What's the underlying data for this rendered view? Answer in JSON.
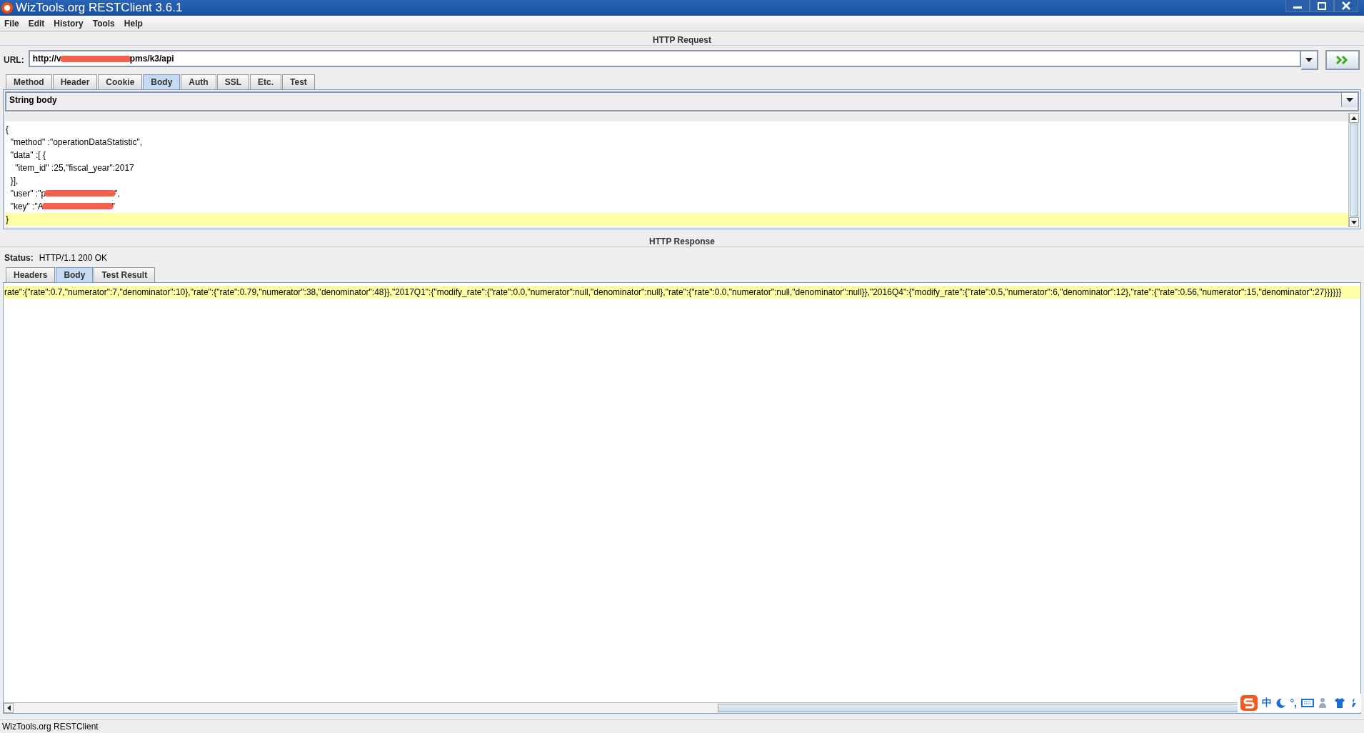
{
  "window": {
    "title": "WizTools.org RESTClient 3.6.1"
  },
  "menu": [
    {
      "label": "File"
    },
    {
      "label": "Edit"
    },
    {
      "label": "History"
    },
    {
      "label": "Tools"
    },
    {
      "label": "Help"
    }
  ],
  "request": {
    "title": "HTTP Request",
    "url_label": "URL:",
    "url_start": "http://v",
    "url_end": "pms/k3/api",
    "tabs": [
      {
        "label": "Method",
        "selected": false
      },
      {
        "label": "Header",
        "selected": false
      },
      {
        "label": "Cookie",
        "selected": false
      },
      {
        "label": "Body",
        "selected": true
      },
      {
        "label": "Auth",
        "selected": false
      },
      {
        "label": "SSL",
        "selected": false
      },
      {
        "label": "Etc.",
        "selected": false
      },
      {
        "label": "Test",
        "selected": false
      }
    ],
    "body_type": "String body",
    "lines": [
      {
        "text": "{",
        "highlighted": false
      },
      {
        "text": "  \"method\" :\"operationDataStatistic\",",
        "highlighted": false
      },
      {
        "text": "  \"data\" :[ {",
        "highlighted": false
      },
      {
        "text": "    \"item_id\" :25,\"fiscal_year\":2017",
        "highlighted": false
      },
      {
        "text": "  }],",
        "highlighted": false
      },
      {
        "text": "  \"user\" :\"p",
        "after": "\",",
        "highlighted": false
      },
      {
        "text": "  \"key\" :\"A",
        "after": "\"",
        "highlighted": false
      },
      {
        "text": "}",
        "highlighted": true
      }
    ]
  },
  "response": {
    "title": "HTTP Response",
    "status_label": "Status:",
    "status": "HTTP/1.1 200 OK",
    "tabs": [
      {
        "label": "Headers",
        "selected": false
      },
      {
        "label": "Body",
        "selected": true
      },
      {
        "label": "Test Result",
        "selected": false
      }
    ],
    "lines": [
      {
        "text": "rate\":{\"rate\":0.7,\"numerator\":7,\"denominator\":10},\"rate\":{\"rate\":0.79,\"numerator\":38,\"denominator\":48}},\"2017Q1\":{\"modify_rate\":{\"rate\":0.0,\"numerator\":null,\"denominator\":null},\"rate\":{\"rate\":0.0,\"numerator\":null,\"denominator\":null}},\"2016Q4\":{\"modify_rate\":{\"rate\":0.5,\"numerator\":6,\"denominator\":12},\"rate\":{\"rate\":0.56,\"numerator\":15,\"denominator\":27}}}}}}",
        "highlighted": true
      }
    ]
  },
  "ime": {
    "mode": "中",
    "punct": "°,"
  },
  "status_bar": "WizTools.org RESTClient"
}
